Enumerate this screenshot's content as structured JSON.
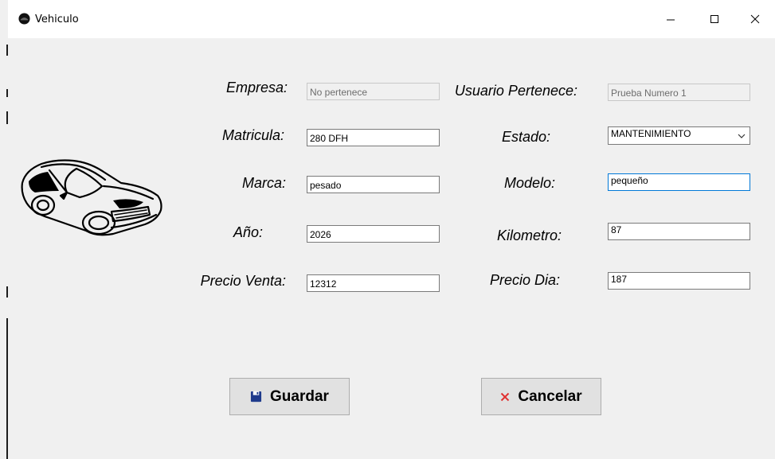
{
  "window": {
    "title": "Vehiculo",
    "icon": "app-dark-circle-icon",
    "controls": [
      "minimize-icon",
      "maximize-icon",
      "close-icon"
    ]
  },
  "form": {
    "empresa": {
      "label": "Empresa:",
      "value": "No pertenece",
      "enabled": false
    },
    "usuario_pertenece": {
      "label": "Usuario Pertenece:",
      "value": "Prueba Numero 1",
      "enabled": false
    },
    "matricula": {
      "label": "Matricula:",
      "value": "280 DFH"
    },
    "estado": {
      "label": "Estado:",
      "value": "MANTENIMIENTO"
    },
    "marca": {
      "label": "Marca:",
      "value": "pesado"
    },
    "modelo": {
      "label": "Modelo:",
      "value": "pequeño",
      "focused": true
    },
    "anio": {
      "label": "Año:",
      "value": "2026"
    },
    "kilometro": {
      "label": "Kilometro:",
      "value": "87"
    },
    "precio_venta": {
      "label": "Precio Venta:",
      "value": "12312"
    },
    "precio_dia": {
      "label": "Precio Dia:",
      "value": "187"
    }
  },
  "buttons": {
    "guardar": {
      "label": "Guardar",
      "icon": "floppy-disk-icon"
    },
    "cancelar": {
      "label": "Cancelar",
      "icon": "red-x-icon"
    }
  },
  "illustration": {
    "icon": "car-outline-icon"
  },
  "colors": {
    "background": "#f0f0f0",
    "titlebar": "#ffffff",
    "focus_border": "#0078d7",
    "save_icon": "#1f3b8c",
    "cancel_icon": "#e03030"
  }
}
